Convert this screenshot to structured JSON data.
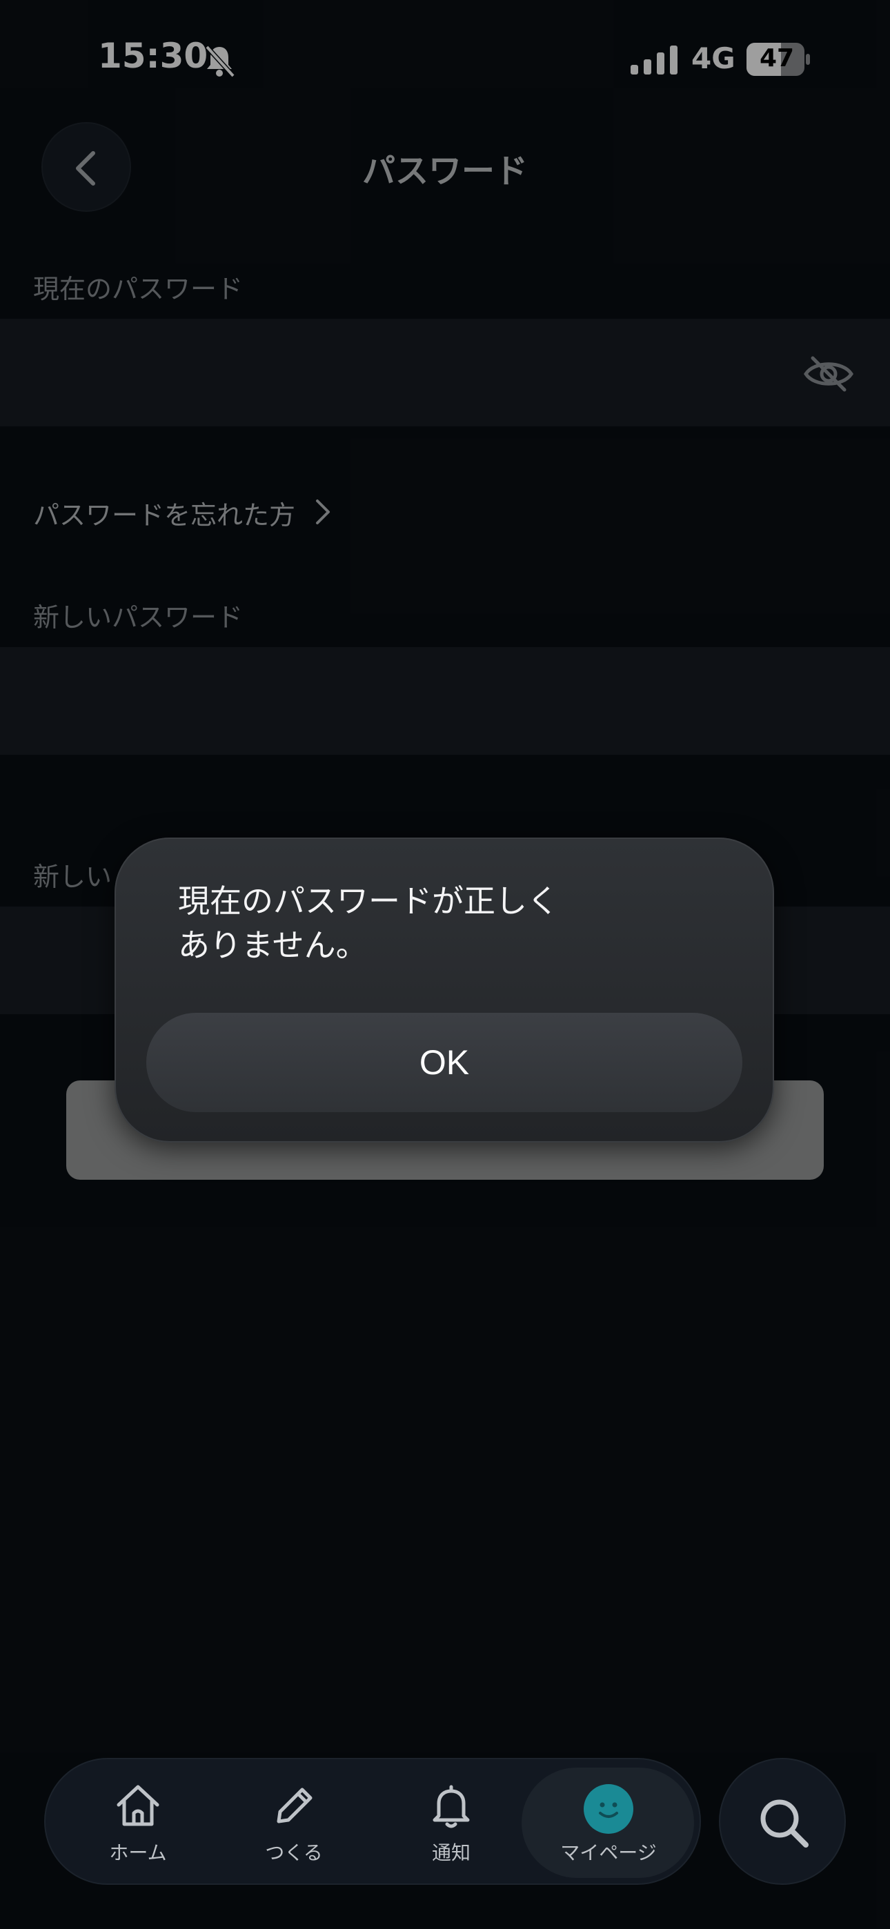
{
  "status_bar": {
    "time": "15:30",
    "network": "4G",
    "battery": "47",
    "icons": [
      "bell-slash-icon",
      "signal-icon",
      "battery-icon"
    ]
  },
  "header": {
    "title": "パスワード",
    "back_icon": "chevron-left-icon"
  },
  "form": {
    "current_password_label": "現在のパスワード",
    "current_password_value": "",
    "visibility_icon": "eye-slash-icon",
    "forgot_link": "パスワードを忘れた方",
    "new_password_label": "新しいパスワード",
    "new_password_value": "",
    "confirm_password_label_visible": "新しい",
    "confirm_password_value": ""
  },
  "alert": {
    "message": "現在のパスワードが正しく\nありません。",
    "ok_label": "OK"
  },
  "tab_bar": {
    "tabs": [
      {
        "label": "ホーム",
        "icon": "home-icon"
      },
      {
        "label": "つくる",
        "icon": "pencil-icon"
      },
      {
        "label": "通知",
        "icon": "bell-icon"
      },
      {
        "label": "マイページ",
        "icon": "avatar-icon",
        "active": true
      }
    ],
    "search_icon": "search-icon"
  },
  "colors": {
    "background": "#090e13",
    "field": "#171c22",
    "alert": "#2a2d31",
    "avatar": "#1a8a95"
  }
}
